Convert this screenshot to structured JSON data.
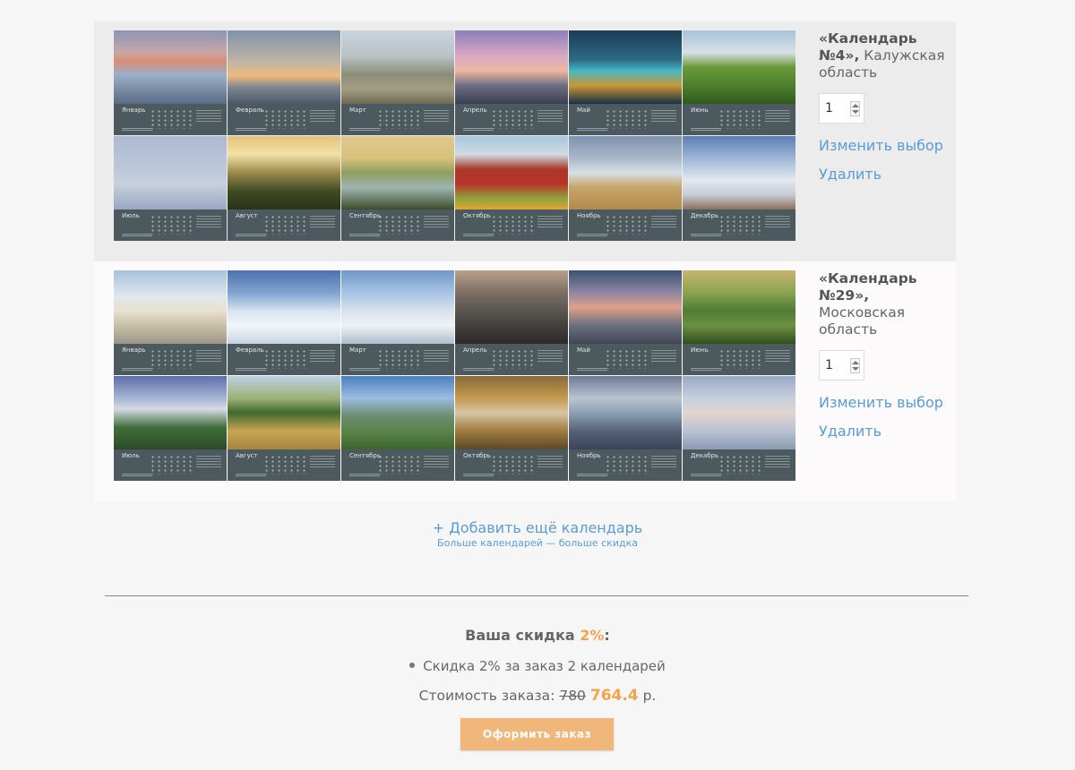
{
  "calendars": [
    {
      "title_bold": "«Календарь №4»,",
      "title_region": "Калужская область",
      "quantity": "1",
      "change_label": "Изменить выбор",
      "remove_label": "Удалить",
      "months": [
        {
          "name": "Январь",
          "photo": "linear-gradient(180deg,#8a96b8 0%,#c9a5a6 30%,#d98c74 42%,#9cb0c8 60%,#5a6a84 100%)"
        },
        {
          "name": "Февраль",
          "photo": "linear-gradient(180deg,#7f93ac 0%,#c3b7a3 45%,#f0b87a 62%,#7c8592 78%,#4d5866 100%)"
        },
        {
          "name": "Март",
          "photo": "linear-gradient(180deg,#c9d4dd 0%,#b8c2c6 35%,#8b8d79 60%,#a49d84 80%,#6f6a55 100%)"
        },
        {
          "name": "Апрель",
          "photo": "linear-gradient(180deg,#8d7fb7 0%,#d9a9c4 35%,#efb79f 55%,#6c6f82 75%,#3b3f55 100%)"
        },
        {
          "name": "Май",
          "photo": "linear-gradient(180deg,#1c3c55 0%,#2e6a84 40%,#46b9c4 55%,#c99635 75%,#173044 100%)"
        },
        {
          "name": "Июнь",
          "photo": "linear-gradient(180deg,#a9c3d9 0%,#d7e0e6 30%,#6b9a3a 50%,#4e7f2c 75%,#2f5a1e 100%)"
        },
        {
          "name": "Июль",
          "photo": "linear-gradient(180deg,#aeb9d2 0%,#b9c6da 40%,#c7d0de 65%,#99a7bf 100%)"
        },
        {
          "name": "Август",
          "photo": "linear-gradient(180deg,#e3c37c 0%,#f3e0a8 25%,#9b8a4c 50%,#3f4a23 75%,#2b3418 100%)"
        },
        {
          "name": "Сентябрь",
          "photo": "linear-gradient(180deg,#e0c78d 0%,#d8c27b 30%,#8e9e5f 50%,#9eb6b0 70%,#3d4e2c 100%)"
        },
        {
          "name": "Октябрь",
          "photo": "linear-gradient(180deg,#a7c6dd 0%,#cfdbe4 25%,#a73927 45%,#b8332a 65%,#8fa33c 85%,#e4a433 100%)"
        },
        {
          "name": "Ноябрь",
          "photo": "linear-gradient(180deg,#7f92ae 0%,#a9b8c9 30%,#d6dfe6 50%,#c7a46a 70%,#b08a4c 100%)"
        },
        {
          "name": "Декабрь",
          "photo": "linear-gradient(180deg,#5d7fb5 0%,#a8bedc 35%,#e4e8ee 60%,#c6ccd6 80%,#8b6f5a 100%)"
        }
      ]
    },
    {
      "title_bold": "«Календарь №29»,",
      "title_region": "Московская область",
      "quantity": "1",
      "change_label": "Изменить выбор",
      "remove_label": "Удалить",
      "months": [
        {
          "name": "Январь",
          "photo": "linear-gradient(180deg,#a8c0dc 0%,#dfe7ee 35%,#e9e1cf 55%,#c7c0a8 75%,#9c958a 100%)"
        },
        {
          "name": "Февраль",
          "photo": "linear-gradient(180deg,#4b73ad 0%,#7fa1cf 30%,#d7e3ef 55%,#f3f6fa 75%,#c7d3e2 100%)"
        },
        {
          "name": "Март",
          "photo": "linear-gradient(180deg,#6f97c9 0%,#a6c3e3 30%,#d7e2ed 55%,#eef2f6 75%,#aebfce 100%)"
        },
        {
          "name": "Апрель",
          "photo": "linear-gradient(180deg,#b8a08a 0%,#7d6f64 30%,#5a5650 55%,#43403c 75%,#2c2a28 100%)"
        },
        {
          "name": "Май",
          "photo": "linear-gradient(180deg,#3a5373 0%,#8d86a2 30%,#e0a08a 50%,#6a6f7d 75%,#3f4756 100%)"
        },
        {
          "name": "Июнь",
          "photo": "linear-gradient(180deg,#c8b46f 0%,#8aa451 30%,#4f7c34 55%,#6d9141 75%,#2f4e1e 100%)"
        },
        {
          "name": "Июль",
          "photo": "linear-gradient(180deg,#5e6fa7 0%,#a4b4d4 30%,#d6dbe4 45%,#3f6e3a 70%,#2b4a28 100%)"
        },
        {
          "name": "Август",
          "photo": "linear-gradient(180deg,#bcd1e4 0%,#9fb27a 30%,#3f6a2c 50%,#c9a654 75%,#a3843f 100%)"
        },
        {
          "name": "Сентябрь",
          "photo": "linear-gradient(180deg,#4a7fc0 0%,#9dbde0 30%,#6b8c6f 55%,#5a8448 75%,#3e6530 100%)"
        },
        {
          "name": "Октябрь",
          "photo": "linear-gradient(180deg,#8a6a3a 0%,#c49a4e 30%,#d7c6a4 50%,#9e7a3e 75%,#5c4a2a 100%)"
        },
        {
          "name": "Ноябрь",
          "photo": "linear-gradient(180deg,#6d7993 0%,#b9c4d3 30%,#8e9fb4 50%,#55627a 75%,#3b4358 100%)"
        },
        {
          "name": "Декабрь",
          "photo": "linear-gradient(180deg,#9aa9c3 0%,#c5cfde 30%,#e2d4cf 50%,#b8c3d3 75%,#8b9ab0 100%)"
        }
      ]
    }
  ],
  "add": {
    "label": "+ Добавить ещё календарь",
    "sub": "Больше календарей — больше скидка"
  },
  "summary": {
    "discount_prefix": "Ваша скидка ",
    "discount_pct": "2%",
    "discount_suffix": ":",
    "discount_item": "Скидка 2% за заказ 2 календарей",
    "cost_label": "Стоимость заказа: ",
    "old_price": "780",
    "new_price": "764.4",
    "currency": "р."
  },
  "order_button": "Оформить заказ",
  "colors": {
    "link": "#5a9bd5",
    "accent": "#f0a44c",
    "button": "#f0b67a"
  }
}
